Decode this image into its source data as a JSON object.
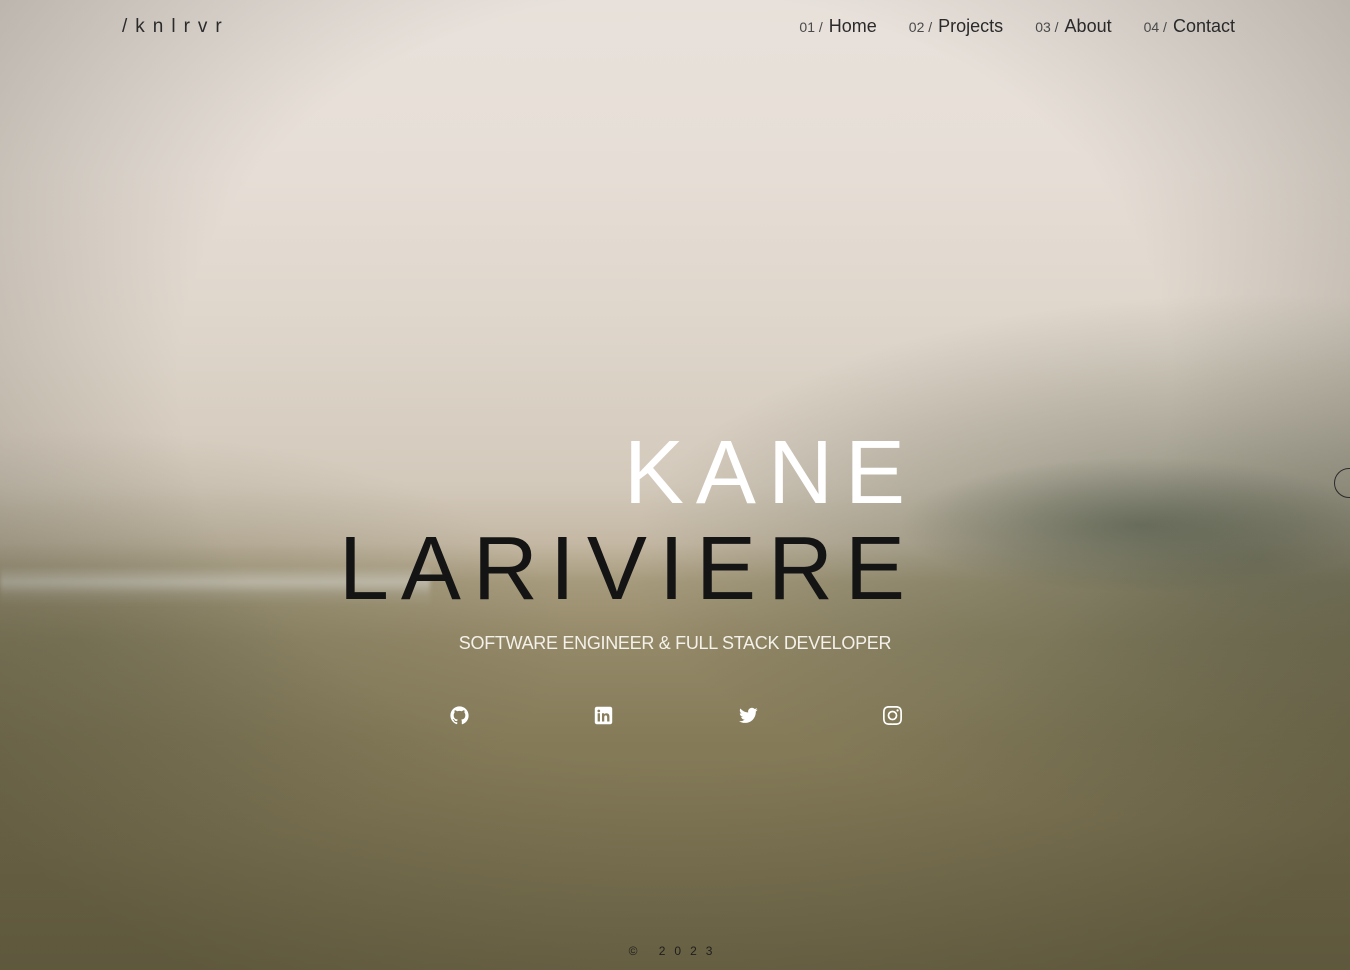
{
  "logo": "/knlrvr",
  "nav": [
    {
      "num": "01 /",
      "label": "Home"
    },
    {
      "num": "02 /",
      "label": "Projects"
    },
    {
      "num": "03 /",
      "label": "About"
    },
    {
      "num": "04 /",
      "label": "Contact"
    }
  ],
  "hero": {
    "first_name": "KANE",
    "last_name": "LARIVIERE",
    "tagline": "SOFTWARE ENGINEER & FULL STACK DEVELOPER"
  },
  "social": [
    {
      "icon": "github-icon"
    },
    {
      "icon": "linkedin-icon"
    },
    {
      "icon": "twitter-icon"
    },
    {
      "icon": "instagram-icon"
    }
  ],
  "footer": "© 2023",
  "colors": {
    "name_first": "#ffffff",
    "name_last": "#141414",
    "tagline": "#f4f1ea"
  }
}
